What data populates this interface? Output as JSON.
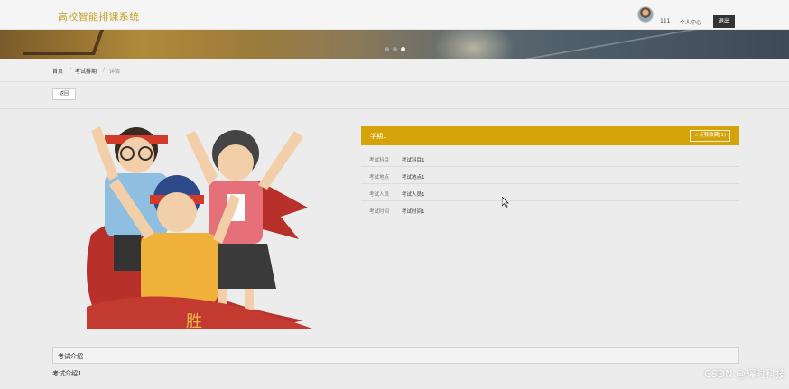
{
  "header": {
    "brand": "高校智能排课系统",
    "username": "111",
    "user_center": "个人中心",
    "logout": "退出"
  },
  "banner": {
    "slides": 3,
    "active_slide": 3
  },
  "breadcrumb": {
    "home": "首页",
    "sep1": "/",
    "section": "考试排期",
    "sep2": "/",
    "current": "详情"
  },
  "toolbar": {
    "back_label": "返回"
  },
  "detail": {
    "title": "学期1",
    "collect_label": "☆点我收藏(1)",
    "fields": [
      {
        "label": "考试科目",
        "value": "考试科目1"
      },
      {
        "label": "考试地点",
        "value": "考试地点1"
      },
      {
        "label": "考试人员",
        "value": "考试人员1"
      },
      {
        "label": "考试时间",
        "value": "考试时间1"
      }
    ]
  },
  "intro": {
    "heading": "考试介绍",
    "body": "考试介绍1"
  },
  "watermark": "CSDN @辉时科技",
  "colors": {
    "brand": "#c9a227",
    "accent": "#d4a30a",
    "logout_bg": "#333333"
  }
}
